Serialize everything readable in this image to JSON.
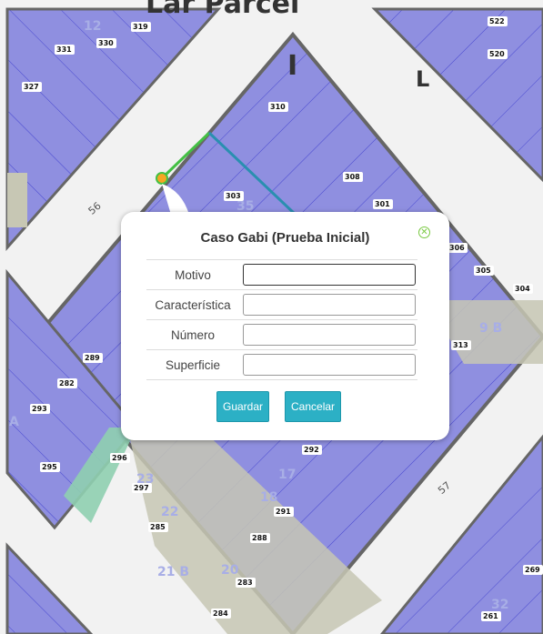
{
  "map": {
    "top_text": "Lar Parcel",
    "streets": [
      "56",
      "57"
    ],
    "section_letters": [
      "I",
      "L"
    ],
    "blocks": [
      "12",
      "35",
      "9 B",
      "23",
      "22",
      "17",
      "18",
      "21 B",
      "20",
      "32",
      "A"
    ],
    "parcels": [
      "319",
      "331",
      "330",
      "327",
      "522",
      "520",
      "310",
      "308",
      "303",
      "301",
      "306",
      "305",
      "304",
      "313",
      "289",
      "282",
      "293",
      "296",
      "295",
      "297",
      "292",
      "291",
      "285",
      "288",
      "283",
      "284",
      "269",
      "261"
    ]
  },
  "dialog": {
    "title": "Caso Gabi (Prueba Inicial)",
    "fields": [
      {
        "label": "Motivo",
        "value": ""
      },
      {
        "label": "Característica",
        "value": ""
      },
      {
        "label": "Número",
        "value": ""
      },
      {
        "label": "Superficie",
        "value": ""
      }
    ],
    "save_label": "Guardar",
    "cancel_label": "Cancelar"
  },
  "colors": {
    "parcel_fill": "#8f8fe0",
    "parcel_line": "#4848d0",
    "street": "#f2f2f2",
    "street_edge": "#777777",
    "green_area": "#8fcfb0",
    "button": "#2cb0c5",
    "close_icon": "#7ac943"
  }
}
